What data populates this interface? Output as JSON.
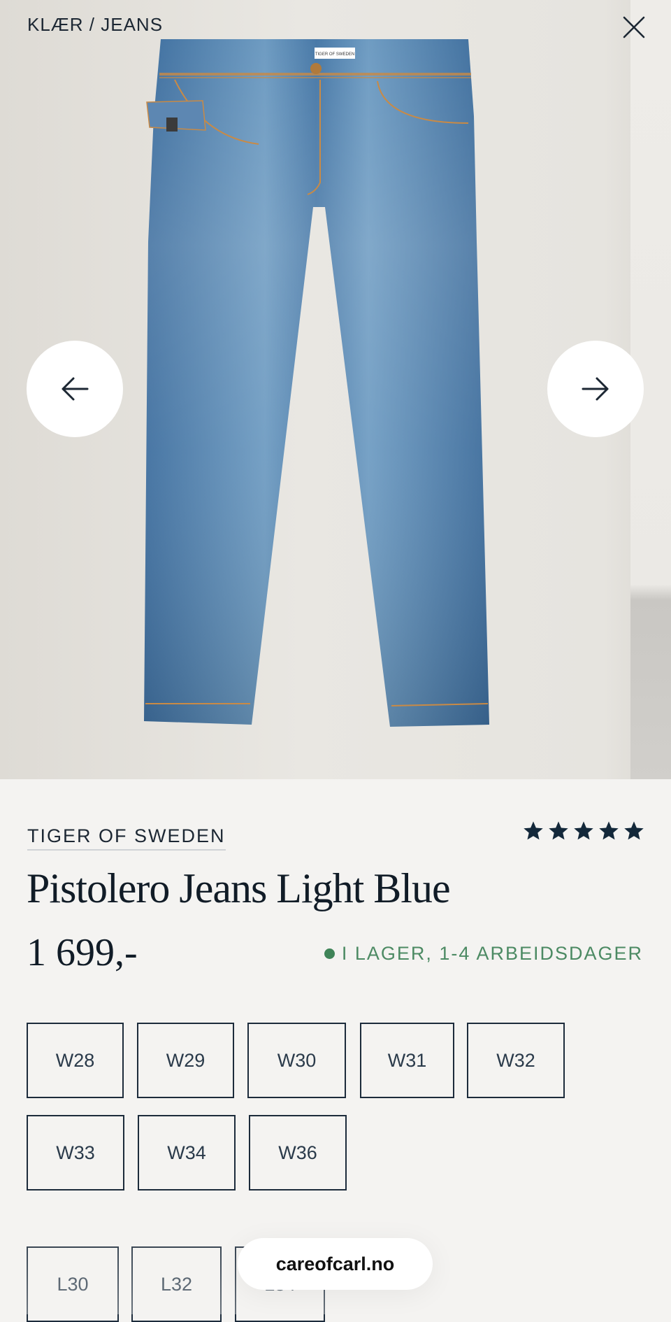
{
  "breadcrumb": "KLÆR / JEANS",
  "gallery": {
    "prev_icon": "arrow-left-icon",
    "next_icon": "arrow-right-icon",
    "close_icon": "close-icon",
    "waistband_label": "TIGER OF SWEDEN"
  },
  "product": {
    "brand": "TIGER OF SWEDEN",
    "name": "Pistolero Jeans Light Blue",
    "price": "1 699,-",
    "rating_stars": 5,
    "stock_status": "I LAGER, 1-4 ARBEIDSDAGER",
    "stock_color": "#3f8458"
  },
  "waist_sizes": [
    "W28",
    "W29",
    "W30",
    "W31",
    "W32",
    "W33",
    "W34",
    "W36"
  ],
  "length_sizes": [
    "L30",
    "L32",
    "L34"
  ],
  "footer": {
    "site": "careofcarl.no"
  },
  "colors": {
    "accent": "#1c2733",
    "background": "#f4f3f1"
  }
}
